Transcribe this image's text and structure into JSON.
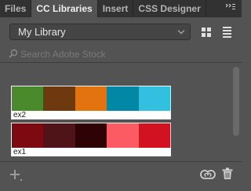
{
  "tabs": [
    {
      "label": "Files",
      "active": false
    },
    {
      "label": "CC Libraries",
      "active": true
    },
    {
      "label": "Insert",
      "active": false
    },
    {
      "label": "CSS Designer",
      "active": false
    }
  ],
  "tab_menu_icon": "panel-menu-icon",
  "library": {
    "selected": "My Library"
  },
  "view_icons": [
    "grid-view-icon",
    "list-view-icon"
  ],
  "search": {
    "placeholder": "Search Adobe Stock",
    "value": ""
  },
  "themes": [
    {
      "name": "ex2",
      "colors": [
        "#4a8a2c",
        "#6e390e",
        "#e2730f",
        "#0288a4",
        "#33bfe0"
      ]
    },
    {
      "name": "ex1",
      "colors": [
        "#7d0a10",
        "#4e1418",
        "#2f0306",
        "#fc5b64",
        "#d21220"
      ]
    }
  ],
  "footer_icons": [
    "add-icon",
    "creative-cloud-icon",
    "trash-icon"
  ],
  "colors": {
    "panel": "#535353",
    "tabbar": "#323232",
    "active_tab": "#535353"
  }
}
